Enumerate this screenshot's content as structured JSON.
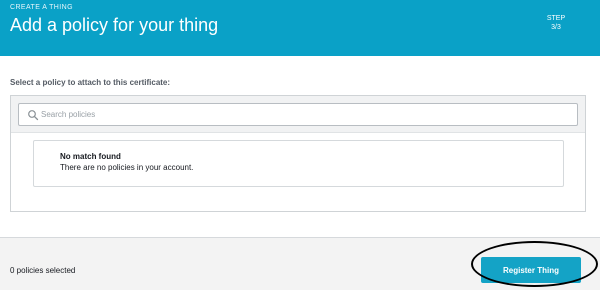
{
  "header": {
    "eyebrow": "CREATE A THING",
    "title": "Add a policy for your thing",
    "step_label": "STEP",
    "step_value": "3/3",
    "background_color": "#0aa1c7"
  },
  "main": {
    "prompt": "Select a policy to attach to this certificate:",
    "search": {
      "placeholder": "Search policies",
      "value": "",
      "icon": "search-icon"
    },
    "empty_state": {
      "title": "No match found",
      "description": "There are no policies in your account."
    }
  },
  "footer": {
    "selected_count_text": "0 policies selected",
    "register_button_label": "Register Thing",
    "button_color": "#14a3c6"
  }
}
